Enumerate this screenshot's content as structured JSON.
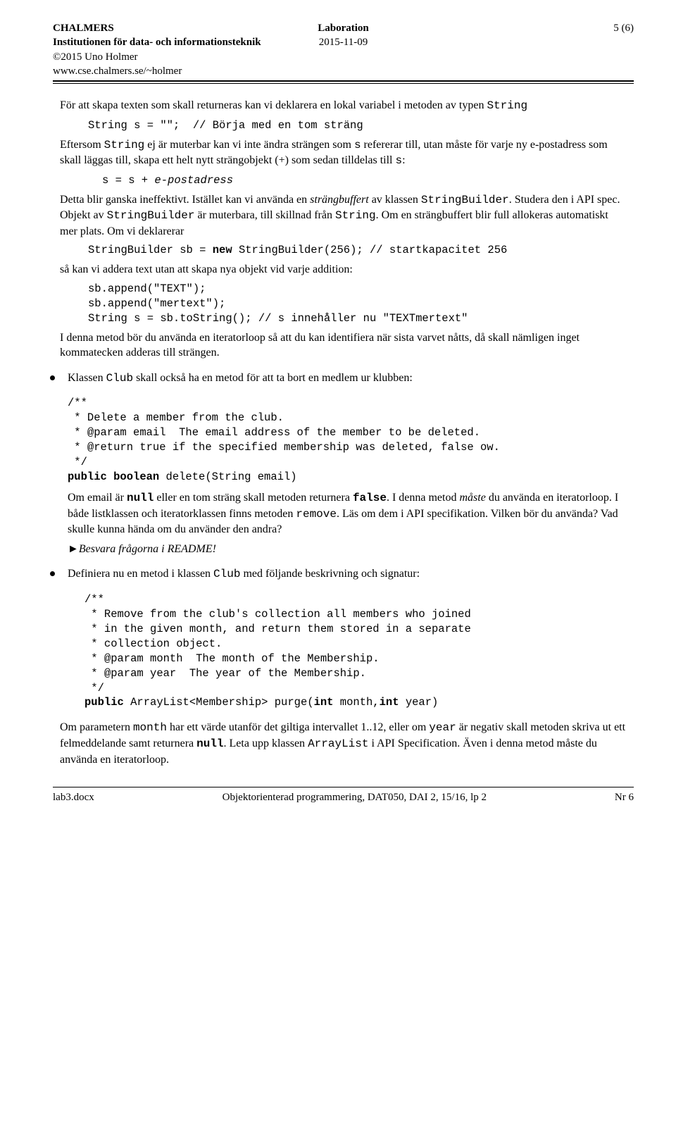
{
  "header": {
    "org": "CHALMERS",
    "dept": "Institutionen för data- och informationsteknik",
    "copyright": "©2015 Uno Holmer",
    "url": "www.cse.chalmers.se/~holmer",
    "title": "Laboration",
    "date": "2015-11-09",
    "page": "5 (6)"
  },
  "p1": "För att skapa texten som skall returneras kan vi deklarera en lokal variabel i metoden av typen ",
  "p1code": "String",
  "codeA": "String s = \"\";  // Börja med en tom sträng",
  "p2a": "Eftersom ",
  "p2b": " ej är muterbar kan vi inte ändra strängen som ",
  "p2c": " refererar till, utan måste för varje ny e-postadress som skall läggas till, skapa ett helt nytt strängobjekt (+) som sedan tilldelas till ",
  "p2d": ":",
  "codeB": "s = s + e-postadress",
  "p3a": "Detta blir ganska ineffektivt. Istället kan vi använda en ",
  "p3italic": "strängbuffert",
  "p3b": " av klassen ",
  "p3c": ". Studera den i API spec. Objekt av ",
  "p3d": " är muterbara, till skillnad från ",
  "p3e": ". Om en strängbuffert blir full allokeras automatiskt mer plats. Om vi deklarerar",
  "codeC": "StringBuilder sb = new StringBuilder(256); // startkapacitet 256",
  "p4": "så kan vi addera text utan att skapa nya objekt vid varje addition:",
  "codeD1": "sb.append(\"TEXT\");",
  "codeD2": "sb.append(\"mertext\");",
  "codeD3": "String s = sb.toString(); // s innehåller nu \"TEXTmertext\"",
  "p5": "I denna metod bör du använda en iteratorloop så att du kan identifiera när sista varvet nåtts, då skall nämligen inget kommatecken adderas till strängen.",
  "bullet1": {
    "intro": "Klassen ",
    "code1": "Club",
    "rest": " skall också ha en metod för att ta bort en medlem ur klubben:",
    "doc1": "/**",
    "doc2": " * Delete a member from the club.",
    "doc3": " * @param email  The email address of the member to be deleted.",
    "doc4": " * @return true if the specified membership was deleted, false ow.",
    "doc5": " */",
    "sig_a": "public boolean ",
    "sig_b": "delete(String email)",
    "para1a": "Om email är ",
    "para1null": "null",
    "para1b": " eller en tom sträng skall metoden returnera ",
    "para1false": "false",
    "para1c": ". I denna metod ",
    "para1must": "måste",
    "para1d": " du använda en iteratorloop. I både listklassen och iteratorklassen finns metoden ",
    "para1rem": "remove",
    "para1e": ". Läs om dem i API specifikation. Vilken bör du använda? Vad skulle kunna hända om du använder den andra?",
    "answer": "►Besvara frågorna i README!"
  },
  "bullet2": {
    "intro": "Definiera nu en metod i klassen ",
    "code1": "Club",
    "rest": " med följande beskrivning och signatur:",
    "doc1": "/**",
    "doc2": " * Remove from the club's collection all members who joined",
    "doc3": " * in the given month, and return them stored in a separate",
    "doc4": " * collection object.",
    "doc5": " * @param month  The month of the Membership.",
    "doc6": " * @param year  The year of the Membership.",
    "doc7": " */",
    "sig_a": "public ",
    "sig_b": "ArrayList<Membership> purge(",
    "sig_c": "int ",
    "sig_d": "month,",
    "sig_e": "int ",
    "sig_f": "year)"
  },
  "p6a": "Om parametern ",
  "p6code1": "month",
  "p6b": " har ett värde utanför det giltiga intervallet 1..12, eller om ",
  "p6code2": "year",
  "p6c": " är negativ skall metoden skriva ut ett felmeddelande samt returnera ",
  "p6null": "null",
  "p6d": ". Leta upp klassen ",
  "p6code3": "ArrayList",
  "p6e": " i API Specification. Även i denna metod måste du använda en iteratorloop.",
  "footer": {
    "left": "lab3.docx",
    "center": "Objektorienterad programmering, DAT050, DAI 2, 15/16, lp 2",
    "right": "Nr  6"
  }
}
